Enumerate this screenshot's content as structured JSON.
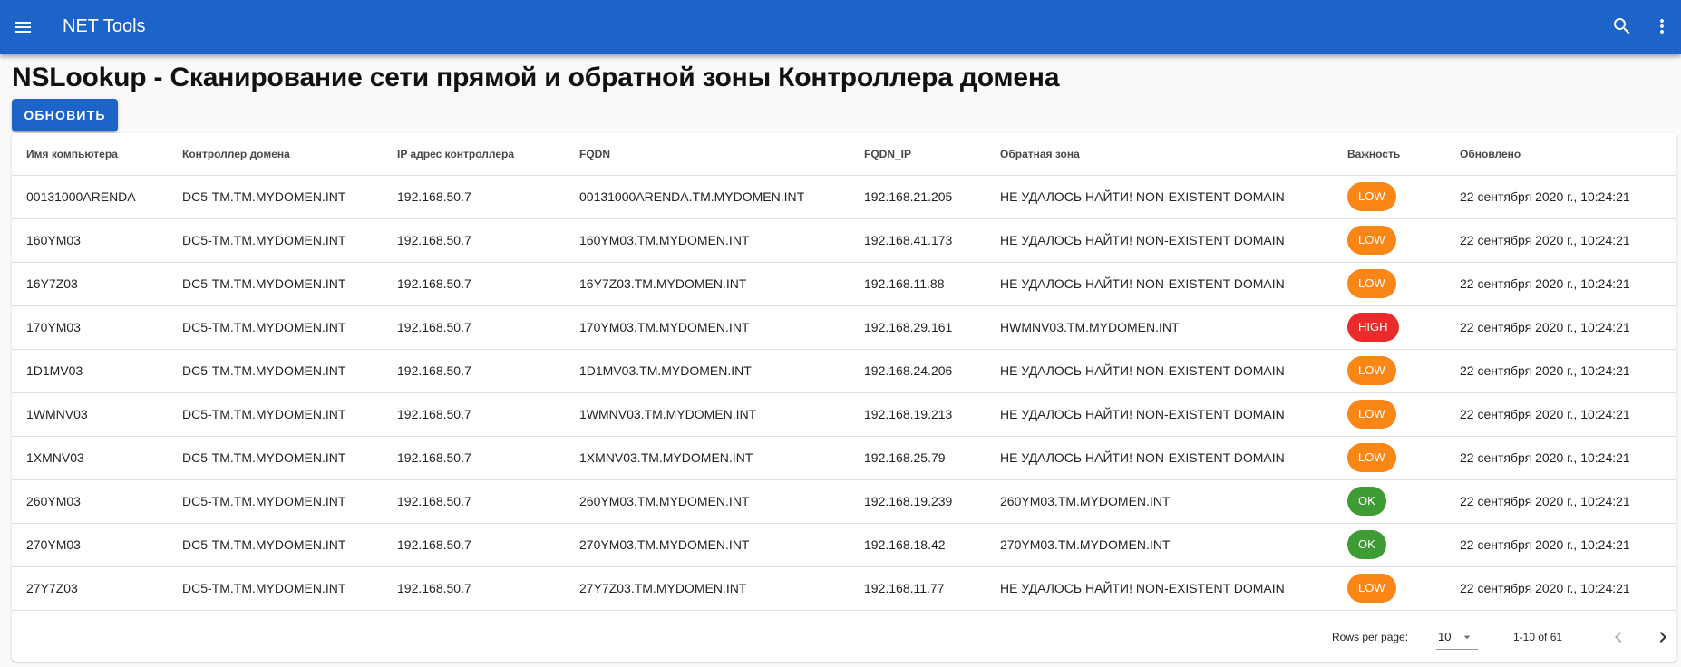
{
  "app": {
    "title": "NET Tools"
  },
  "page": {
    "title": "NSLookup - Сканирование сети прямой и обратной зоны Контроллера домена",
    "refresh_label": "ОБНОВИТЬ"
  },
  "colors": {
    "appbar": "#1e63c8",
    "low": "#fa8616",
    "high": "#ea2b2b",
    "ok": "#3f9b33"
  },
  "table": {
    "columns": [
      "Имя компьютера",
      "Контроллер домена",
      "IP адрес контроллера",
      "FQDN",
      "FQDN_IP",
      "Обратная зона",
      "Важность",
      "Обновлено"
    ],
    "rows": [
      [
        "00131000ARENDA",
        "DC5-TM.TM.MYDOMEN.INT",
        "192.168.50.7",
        "00131000ARENDA.TM.MYDOMEN.INT",
        "192.168.21.205",
        "НЕ УДАЛОСЬ НАЙТИ! NON-EXISTENT DOMAIN",
        "LOW",
        "22 сентября 2020 г., 10:24:21"
      ],
      [
        "160YM03",
        "DC5-TM.TM.MYDOMEN.INT",
        "192.168.50.7",
        "160YM03.TM.MYDOMEN.INT",
        "192.168.41.173",
        "НЕ УДАЛОСЬ НАЙТИ! NON-EXISTENT DOMAIN",
        "LOW",
        "22 сентября 2020 г., 10:24:21"
      ],
      [
        "16Y7Z03",
        "DC5-TM.TM.MYDOMEN.INT",
        "192.168.50.7",
        "16Y7Z03.TM.MYDOMEN.INT",
        "192.168.11.88",
        "НЕ УДАЛОСЬ НАЙТИ! NON-EXISTENT DOMAIN",
        "LOW",
        "22 сентября 2020 г., 10:24:21"
      ],
      [
        "170YM03",
        "DC5-TM.TM.MYDOMEN.INT",
        "192.168.50.7",
        "170YM03.TM.MYDOMEN.INT",
        "192.168.29.161",
        "HWMNV03.TM.MYDOMEN.INT",
        "HIGH",
        "22 сентября 2020 г., 10:24:21"
      ],
      [
        "1D1MV03",
        "DC5-TM.TM.MYDOMEN.INT",
        "192.168.50.7",
        "1D1MV03.TM.MYDOMEN.INT",
        "192.168.24.206",
        "НЕ УДАЛОСЬ НАЙТИ! NON-EXISTENT DOMAIN",
        "LOW",
        "22 сентября 2020 г., 10:24:21"
      ],
      [
        "1WMNV03",
        "DC5-TM.TM.MYDOMEN.INT",
        "192.168.50.7",
        "1WMNV03.TM.MYDOMEN.INT",
        "192.168.19.213",
        "НЕ УДАЛОСЬ НАЙТИ! NON-EXISTENT DOMAIN",
        "LOW",
        "22 сентября 2020 г., 10:24:21"
      ],
      [
        "1XMNV03",
        "DC5-TM.TM.MYDOMEN.INT",
        "192.168.50.7",
        "1XMNV03.TM.MYDOMEN.INT",
        "192.168.25.79",
        "НЕ УДАЛОСЬ НАЙТИ! NON-EXISTENT DOMAIN",
        "LOW",
        "22 сентября 2020 г., 10:24:21"
      ],
      [
        "260YM03",
        "DC5-TM.TM.MYDOMEN.INT",
        "192.168.50.7",
        "260YM03.TM.MYDOMEN.INT",
        "192.168.19.239",
        "260YM03.TM.MYDOMEN.INT",
        "OK",
        "22 сентября 2020 г., 10:24:21"
      ],
      [
        "270YM03",
        "DC5-TM.TM.MYDOMEN.INT",
        "192.168.50.7",
        "270YM03.TM.MYDOMEN.INT",
        "192.168.18.42",
        "270YM03.TM.MYDOMEN.INT",
        "OK",
        "22 сентября 2020 г., 10:24:21"
      ],
      [
        "27Y7Z03",
        "DC5-TM.TM.MYDOMEN.INT",
        "192.168.50.7",
        "27Y7Z03.TM.MYDOMEN.INT",
        "192.168.11.77",
        "НЕ УДАЛОСЬ НАЙТИ! NON-EXISTENT DOMAIN",
        "LOW",
        "22 сентября 2020 г., 10:24:21"
      ]
    ]
  },
  "pagination": {
    "rows_per_page_label": "Rows per page:",
    "rows_per_page": "10",
    "displayed": "1-10 of 61"
  }
}
